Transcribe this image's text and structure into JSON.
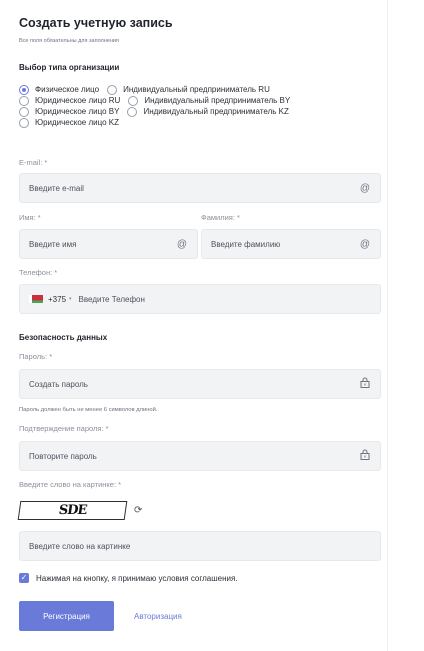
{
  "form": {
    "title": "Создать учетную запись",
    "subtitle": "Все поля обязательны для заполнения",
    "org_section_title": "Выбор типа организации",
    "org_types": [
      {
        "label": "Физическое лицо",
        "checked": true
      },
      {
        "label": "Индивидуальный предприниматель RU",
        "checked": false
      },
      {
        "label": "Юридическое лицо RU",
        "checked": false
      },
      {
        "label": "Индивидуальный предприниматель BY",
        "checked": false
      },
      {
        "label": "Юридическое лицо BY",
        "checked": false
      },
      {
        "label": "Индивидуальный предприниматель KZ",
        "checked": false
      },
      {
        "label": "Юридическое лицо KZ",
        "checked": false
      }
    ],
    "email": {
      "label": "E-mail: *",
      "placeholder": "Введите e-mail",
      "value": "",
      "icon": "at-icon"
    },
    "first_name": {
      "label": "Имя: *",
      "placeholder": "Введите имя",
      "value": "",
      "icon": "at-icon"
    },
    "last_name": {
      "label": "Фамилия: *",
      "placeholder": "Введите фамилию",
      "value": "",
      "icon": "at-icon"
    },
    "phone": {
      "label": "Телефон: *",
      "country_code": "+375",
      "placeholder": "Введите Телефон",
      "value": "",
      "flag": "BY"
    },
    "security_section_title": "Безопасность данных",
    "password": {
      "label": "Пароль: *",
      "placeholder": "Создать пароль",
      "value": "",
      "icon": "lock-icon",
      "hint": "Пароль должен быть не менее 6 символов длиной."
    },
    "password_confirm": {
      "label": "Подтверждение пароля: *",
      "placeholder": "Повторите пароль",
      "value": "",
      "icon": "lock-icon"
    },
    "captcha": {
      "label": "Введите слово на картинке: *",
      "image_text": "SDE",
      "placeholder": "Введите слово на картинке",
      "value": "",
      "refresh_icon": "refresh-icon"
    },
    "agreement": {
      "label": "Нажимая на кнопку, я принимаю условия соглашения.",
      "checked": true
    },
    "register_label": "Регистрация",
    "login_label": "Авторизация"
  },
  "colors": {
    "accent": "#6a7ad8",
    "field_bg": "#f2f3f5",
    "text": "#2b2f36",
    "muted": "#8a909b"
  }
}
